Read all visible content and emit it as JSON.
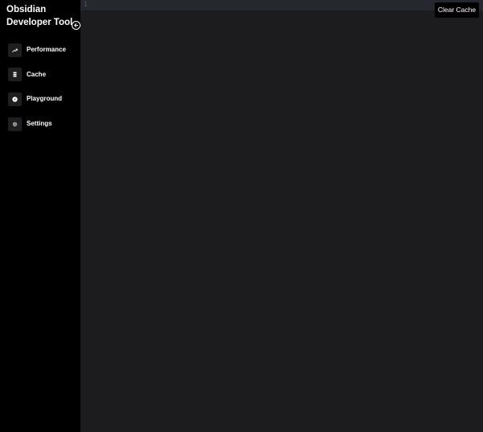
{
  "app": {
    "title": "Obsidian Developer Tool"
  },
  "sidebar": {
    "collapse_icon": "arrow-left-circle-icon",
    "items": [
      {
        "label": "Performance",
        "icon": "trending-up-icon"
      },
      {
        "label": "Cache",
        "icon": "database-icon"
      },
      {
        "label": "Playground",
        "icon": "compass-icon"
      },
      {
        "label": "Settings",
        "icon": "gear-icon"
      }
    ]
  },
  "editor": {
    "line_numbers": [
      "1"
    ]
  },
  "toolbar": {
    "clear_cache_label": "Clear Cache"
  },
  "colors": {
    "sidebar_bg": "#000000",
    "editor_bg": "#1c1b1e",
    "editor_bar_bg": "#262830",
    "icon_tile_bg": "#1f1f22",
    "text": "#ffffff",
    "line_number": "#5a5c66"
  }
}
